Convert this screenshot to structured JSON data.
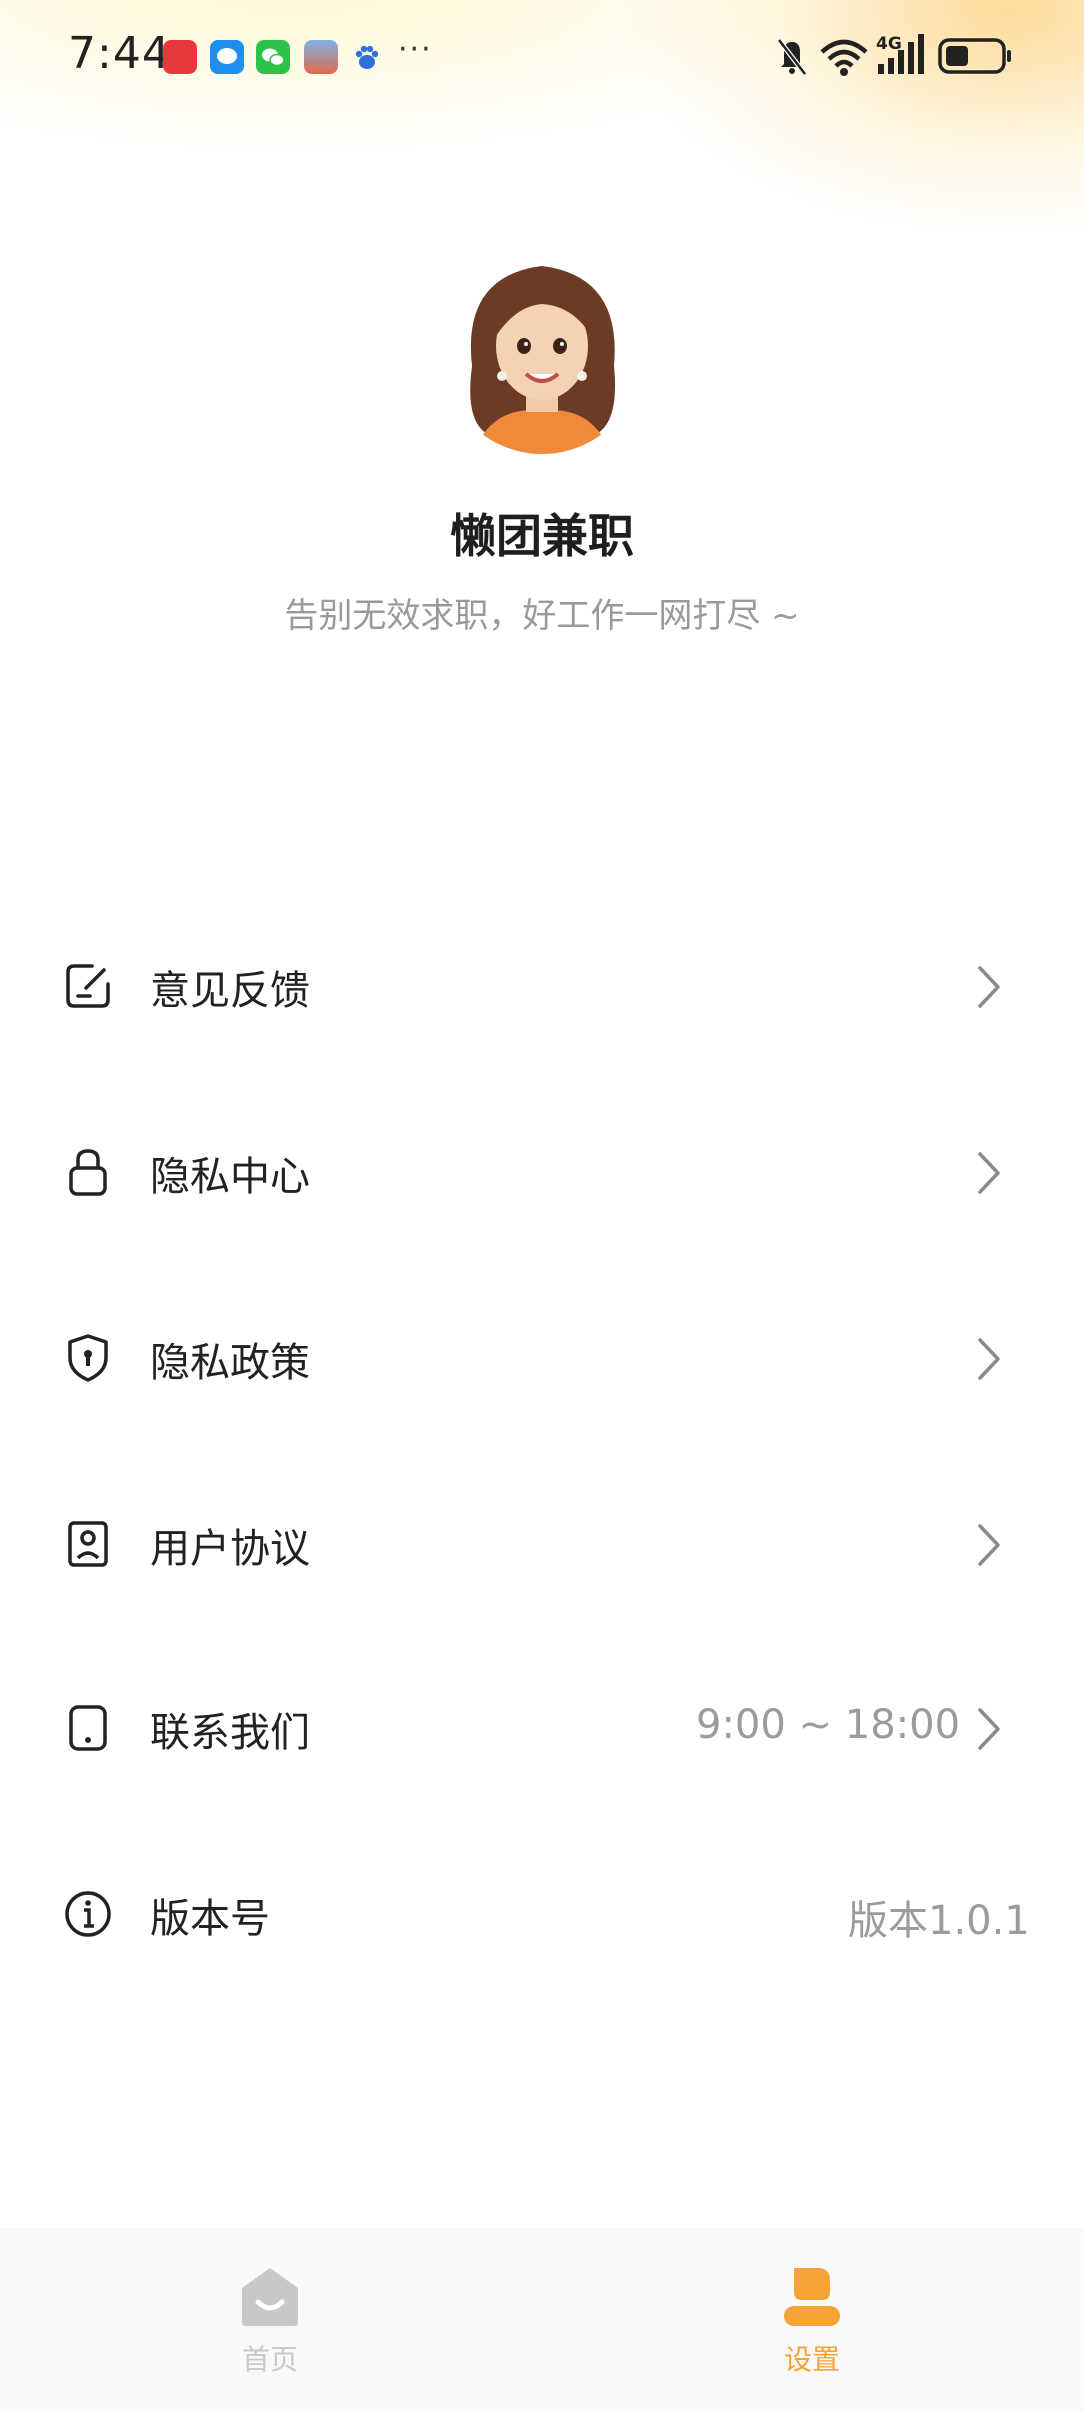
{
  "status_bar": {
    "time": "7:44",
    "notification_icons": [
      "huawei-store-icon",
      "messages-icon",
      "wechat-icon",
      "game-icon",
      "baidu-icon"
    ],
    "more": "···",
    "network": "4G"
  },
  "profile": {
    "app_name": "懒团兼职",
    "slogan": "告别无效求职，好工作一网打尽 ~"
  },
  "menu": [
    {
      "icon": "edit-feedback-icon",
      "label": "意见反馈",
      "value": "",
      "has_arrow": true
    },
    {
      "icon": "lock-icon",
      "label": "隐私中心",
      "value": "",
      "has_arrow": true
    },
    {
      "icon": "shield-icon",
      "label": "隐私政策",
      "value": "",
      "has_arrow": true
    },
    {
      "icon": "user-agreement-icon",
      "label": "用户协议",
      "value": "",
      "has_arrow": true
    },
    {
      "icon": "phone-icon",
      "label": "联系我们",
      "value": "9:00 ~ 18:00",
      "has_arrow": true
    },
    {
      "icon": "info-icon",
      "label": "版本号",
      "value": "版本1.0.1",
      "has_arrow": false
    }
  ],
  "bottom_nav": {
    "items": [
      {
        "icon": "home-icon",
        "label": "首页",
        "active": false
      },
      {
        "icon": "user-icon",
        "label": "设置",
        "active": true
      }
    ]
  },
  "colors": {
    "accent": "#f5a236",
    "inactive_nav": "#c8c8c8",
    "text_primary": "#222222",
    "text_secondary": "#9a9a9a"
  }
}
